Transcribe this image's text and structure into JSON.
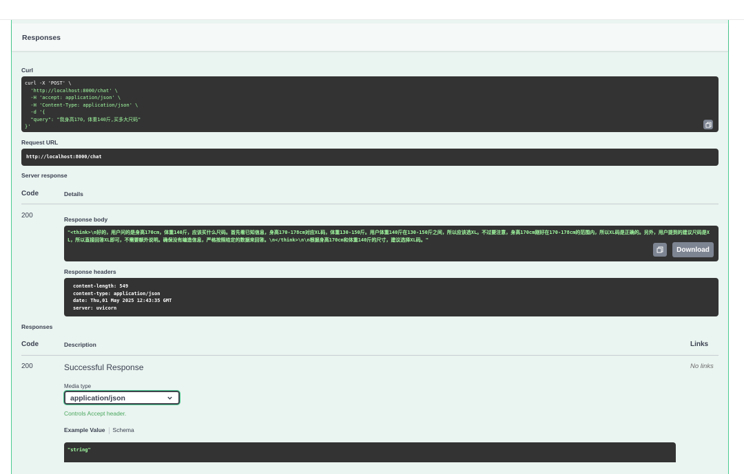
{
  "responses_header": {
    "title": "Responses"
  },
  "curl": {
    "label": "Curl",
    "lines": [
      "curl -X 'POST' \\",
      "  'http://localhost:8000/chat' \\",
      "  -H 'accept: application/json' \\",
      "  -H 'Content-Type: application/json' \\",
      "  -d '{",
      "  \"query\": \"我身高170，体重140斤,买多大尺码\"",
      "}'"
    ]
  },
  "request_url": {
    "label": "Request URL",
    "value": "http://localhost:8000/chat"
  },
  "server_response": {
    "label": "Server response",
    "col_code": "Code",
    "col_details": "Details",
    "code": "200",
    "body_label": "Response body",
    "body_text": "\"<think>\\n好的，用户问的是身高170cm，体重140斤，应该买什么尺码。首先看已知信息，身高170-178cm对应XL码，体重130-150斤。用户体重140斤在130-150斤之间，所以应该选XL。不过要注意，身高170cm刚好在170-178cm的范围内，所以XL码是正确的。另外，用户提到的建议尺码是XL，所以直接回答XL即可，不需要额外说明。确保没有编造信息，严格按照给定的数据来回答。\\n</think>\\n\\n根据身高170cm和体重140斤的尺寸，建议选择XL码。\"",
    "download_label": "Download",
    "headers_label": "Response headers",
    "headers": [
      "content-length: 549",
      "content-type: application/json",
      "date: Thu,01 May 2025 12:43:35 GMT",
      "server: uvicorn"
    ]
  },
  "responses": {
    "label": "Responses",
    "col_code": "Code",
    "col_description": "Description",
    "col_links": "Links",
    "code": "200",
    "description": "Successful Response",
    "links": "No links",
    "media_type_label": "Media type",
    "media_type_value": "application/json",
    "controls_note": "Controls Accept header.",
    "tab_example": "Example Value",
    "tab_schema": "Schema",
    "example_value": "\"string\""
  },
  "icons": [
    "copy-icon",
    "chevron-down-icon"
  ],
  "colors": {
    "panel_bg": "#eaf4f0",
    "accent": "#49cc90",
    "code_bg": "#333333",
    "string_green": "#a2fca2"
  }
}
